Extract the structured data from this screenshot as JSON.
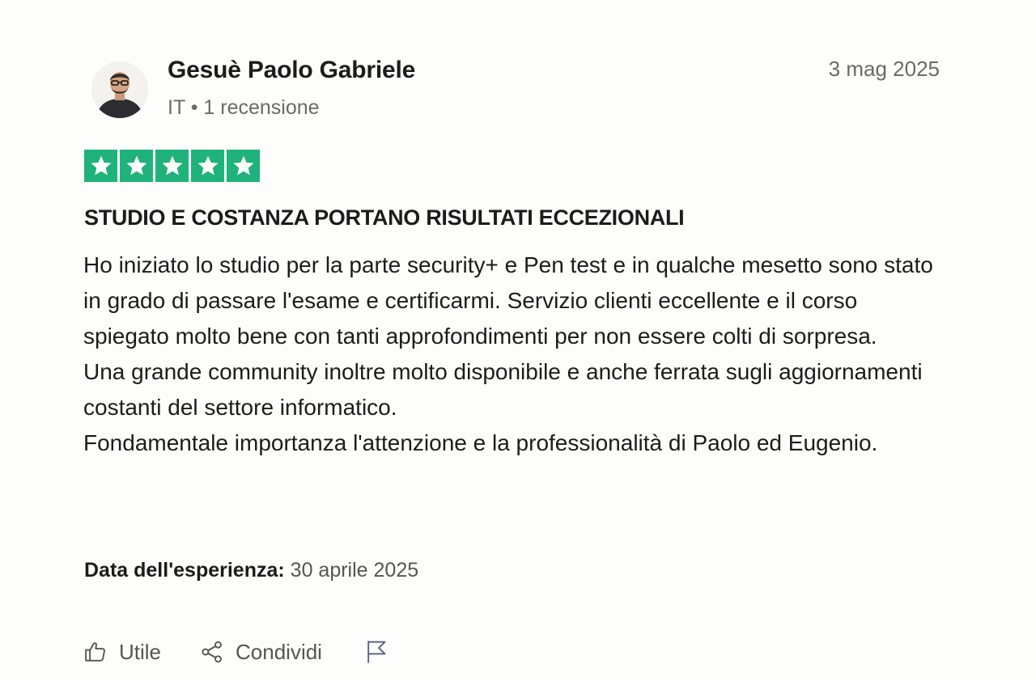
{
  "author": {
    "name": "Gesuè Paolo Gabriele",
    "meta": "IT • 1 recensione",
    "avatar_icon": "user-avatar-photo"
  },
  "review": {
    "date": "3 mag 2025",
    "rating": 5,
    "rating_max": 5,
    "star_color": "#1fb37b",
    "title": "STUDIO E COSTANZA PORTANO RISULTATI ECCEZIONALI",
    "paragraphs": [
      "Ho iniziato lo studio per la parte security+ e Pen test e in qualche mesetto sono stato in grado di passare l'esame e certificarmi. Servizio clienti eccellente e il corso spiegato molto bene con tanti approfondimenti per non essere colti di sorpresa.",
      "Una grande community inoltre molto disponibile e anche ferrata sugli aggiornamenti costanti del settore informatico.",
      "Fondamentale importanza l'attenzione e la professionalità di Paolo ed Eugenio."
    ],
    "experience_label": "Data dell'esperienza:",
    "experience_date": "30 aprile 2025"
  },
  "actions": {
    "useful_label": "Utile",
    "useful_icon": "thumbs-up-icon",
    "share_label": "Condividi",
    "share_icon": "share-icon",
    "report_icon": "flag-icon"
  }
}
